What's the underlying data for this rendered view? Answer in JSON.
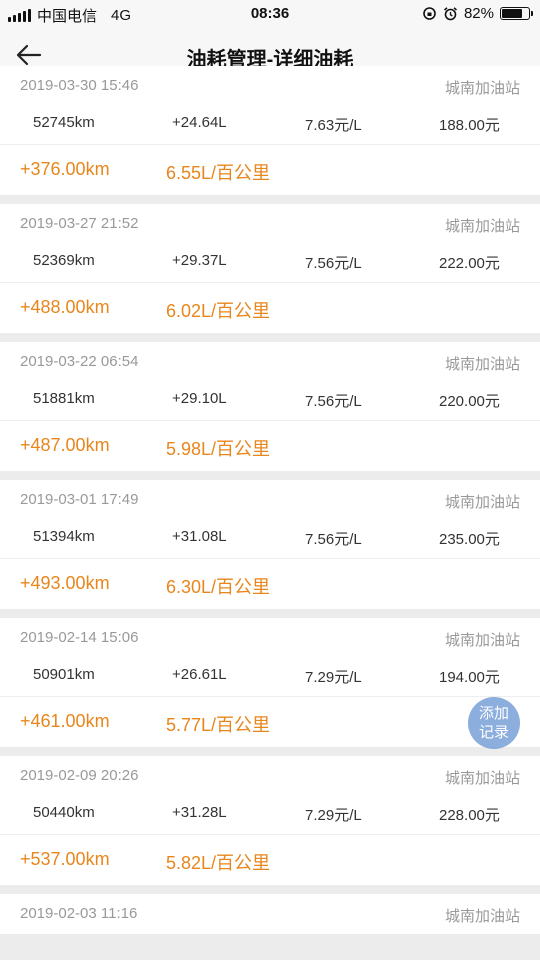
{
  "status_bar": {
    "carrier": "中国电信",
    "network": "4G",
    "time": "08:36",
    "battery": "82%",
    "battery_level": 0.82
  },
  "nav": {
    "title": "油耗管理-详细油耗",
    "back_icon": "arrow-left-icon"
  },
  "records": [
    {
      "date": "2019-03-30 15:46",
      "station": "城南加油站",
      "odometer": "52745km",
      "fuel": "+24.64L",
      "price": "7.63元/L",
      "amount": "188.00元",
      "distance": "+376.00km",
      "consumption": "6.55L/百公里"
    },
    {
      "date": "2019-03-27 21:52",
      "station": "城南加油站",
      "odometer": "52369km",
      "fuel": "+29.37L",
      "price": "7.56元/L",
      "amount": "222.00元",
      "distance": "+488.00km",
      "consumption": "6.02L/百公里"
    },
    {
      "date": "2019-03-22 06:54",
      "station": "城南加油站",
      "odometer": "51881km",
      "fuel": "+29.10L",
      "price": "7.56元/L",
      "amount": "220.00元",
      "distance": "+487.00km",
      "consumption": "5.98L/百公里"
    },
    {
      "date": "2019-03-01 17:49",
      "station": "城南加油站",
      "odometer": "51394km",
      "fuel": "+31.08L",
      "price": "7.56元/L",
      "amount": "235.00元",
      "distance": "+493.00km",
      "consumption": "6.30L/百公里"
    },
    {
      "date": "2019-02-14 15:06",
      "station": "城南加油站",
      "odometer": "50901km",
      "fuel": "+26.61L",
      "price": "7.29元/L",
      "amount": "194.00元",
      "distance": "+461.00km",
      "consumption": "5.77L/百公里"
    },
    {
      "date": "2019-02-09 20:26",
      "station": "城南加油站",
      "odometer": "50440km",
      "fuel": "+31.28L",
      "price": "7.29元/L",
      "amount": "228.00元",
      "distance": "+537.00km",
      "consumption": "5.82L/百公里"
    },
    {
      "date": "2019-02-03 11:16",
      "station": "城南加油站",
      "odometer": "",
      "fuel": "",
      "price": "",
      "amount": "",
      "distance": "",
      "consumption": ""
    }
  ],
  "fab": {
    "line1": "添加",
    "line2": "记录"
  }
}
